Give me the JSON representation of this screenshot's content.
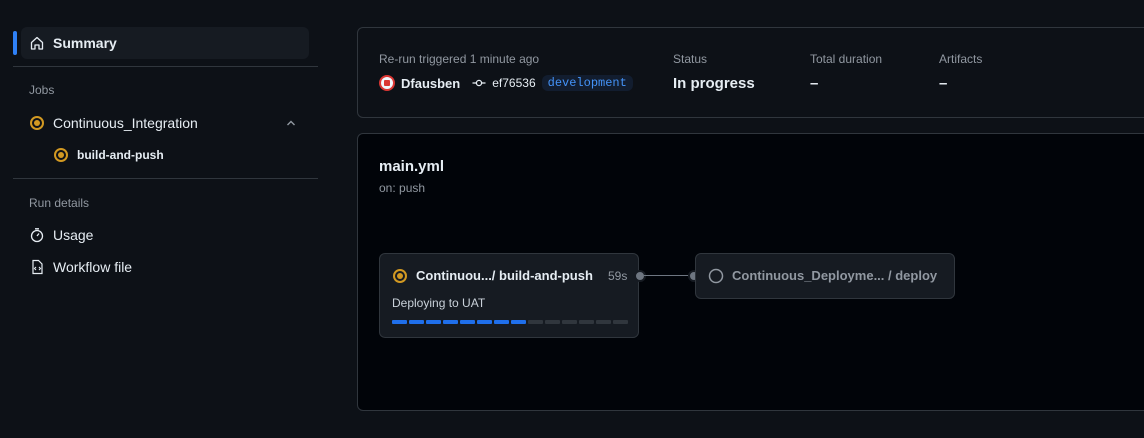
{
  "sidebar": {
    "summary_label": "Summary",
    "jobs_heading": "Jobs",
    "jobs": [
      {
        "label": "Continuous_Integration"
      },
      {
        "label": "build-and-push"
      }
    ],
    "run_details_heading": "Run details",
    "details": [
      {
        "label": "Usage"
      },
      {
        "label": "Workflow file"
      }
    ]
  },
  "run_info": {
    "trigger_label": "Re-run triggered 1 minute ago",
    "user": "Dfausben",
    "commit": "ef76536",
    "branch": "development",
    "status_label": "Status",
    "status_value": "In progress",
    "duration_label": "Total duration",
    "duration_value": "–",
    "artifacts_label": "Artifacts",
    "artifacts_value": "–"
  },
  "graph": {
    "workflow_file": "main.yml",
    "trigger": "on: push",
    "job1": {
      "name": "Continuou.../ build-and-push",
      "duration": "59s",
      "step": "Deploying to UAT",
      "progress_segments_done": 8,
      "progress_segments_total": 14
    },
    "job2": {
      "name": "Continuous_Deployme... / deploy"
    }
  },
  "colors": {
    "accent": "#2f81f7",
    "in_progress": "#d29922",
    "progress_fill": "#1f6feb",
    "progress_empty": "#30363d"
  }
}
